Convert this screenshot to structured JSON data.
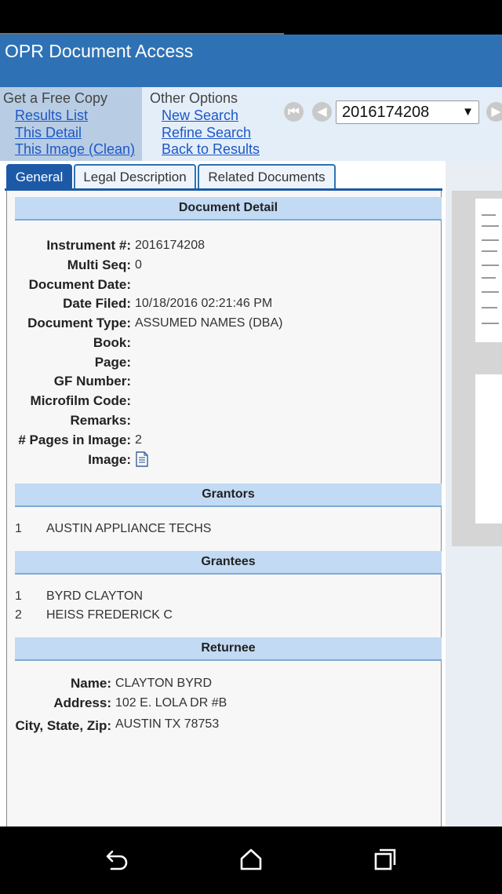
{
  "header": {
    "title": "OPR Document Access"
  },
  "free_copy": {
    "heading": "Get a Free Copy",
    "links": [
      "Results List",
      "This Detail",
      "This Image (Clean)"
    ]
  },
  "other_options": {
    "heading": "Other Options",
    "links": [
      "New Search",
      "Refine Search",
      "Back to Results"
    ]
  },
  "instrument_select": {
    "selected": "2016174208"
  },
  "tabs": [
    "General",
    "Legal Description",
    "Related Documents"
  ],
  "active_tab": "General",
  "document_detail": {
    "header": "Document Detail",
    "fields": [
      {
        "label": "Instrument #:",
        "value": "2016174208"
      },
      {
        "label": "Multi Seq:",
        "value": "0"
      },
      {
        "label": "Document Date:",
        "value": ""
      },
      {
        "label": "Date Filed:",
        "value": "10/18/2016 02:21:46 PM"
      },
      {
        "label": "Document Type:",
        "value": "ASSUMED NAMES (DBA)"
      },
      {
        "label": "Book:",
        "value": ""
      },
      {
        "label": "Page:",
        "value": ""
      },
      {
        "label": "GF Number:",
        "value": ""
      },
      {
        "label": "Microfilm Code:",
        "value": ""
      },
      {
        "label": "Remarks:",
        "value": ""
      },
      {
        "label": "# Pages in Image:",
        "value": "2"
      },
      {
        "label": "Image:",
        "value": ""
      }
    ]
  },
  "grantors": {
    "header": "Grantors",
    "items": [
      {
        "num": "1",
        "name": "AUSTIN APPLIANCE TECHS"
      }
    ]
  },
  "grantees": {
    "header": "Grantees",
    "items": [
      {
        "num": "1",
        "name": "BYRD  CLAYTON"
      },
      {
        "num": "2",
        "name": "HEISS  FREDERICK C"
      }
    ]
  },
  "returnee": {
    "header": "Returnee",
    "fields": [
      {
        "label": "Name:",
        "value": "CLAYTON BYRD"
      },
      {
        "label": "Address:",
        "value": "102 E. LOLA DR #B"
      },
      {
        "label": "City, State, Zip:",
        "value": "AUSTIN  TX  78753"
      }
    ]
  },
  "icons": {
    "first_page": "first-page-icon",
    "prev_page": "prev-page-icon",
    "next_page": "next-page-icon",
    "image": "document-icon",
    "back": "back-icon",
    "home": "home-icon",
    "recents": "recents-icon"
  },
  "colors": {
    "header_bg": "#2e72b5",
    "section_header_bg": "#c2daf3",
    "link": "#1d57c9",
    "active_tab": "#1c5aa8"
  }
}
